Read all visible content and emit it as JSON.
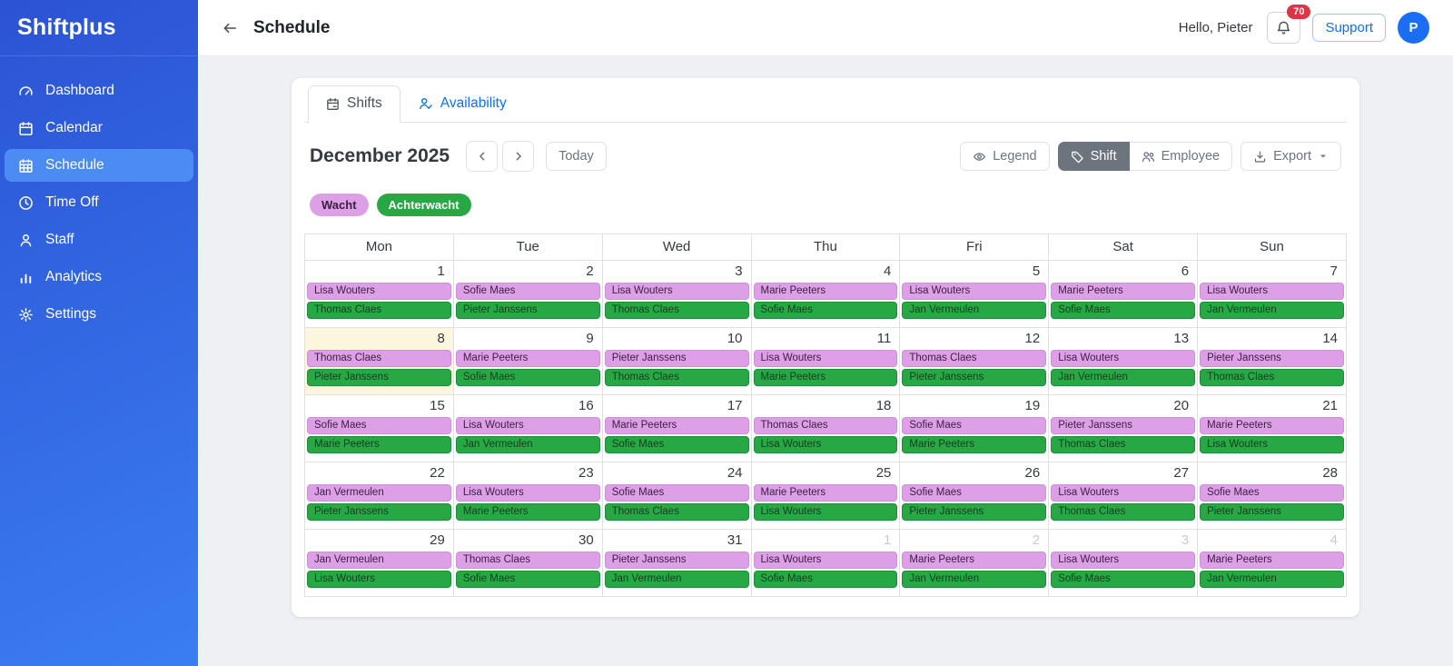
{
  "brand": "Shiftplus",
  "sidebar": {
    "items": [
      {
        "label": "Dashboard",
        "icon": "gauge-icon",
        "active": false
      },
      {
        "label": "Calendar",
        "icon": "calendar-icon",
        "active": false
      },
      {
        "label": "Schedule",
        "icon": "schedule-icon",
        "active": true
      },
      {
        "label": "Time Off",
        "icon": "clock-icon",
        "active": false
      },
      {
        "label": "Staff",
        "icon": "person-icon",
        "active": false
      },
      {
        "label": "Analytics",
        "icon": "bar-chart-icon",
        "active": false
      },
      {
        "label": "Settings",
        "icon": "gear-icon",
        "active": false
      }
    ]
  },
  "header": {
    "title": "Schedule",
    "greeting": "Hello, Pieter",
    "notification_count": "70",
    "support_label": "Support",
    "avatar_initial": "P"
  },
  "tabs": [
    {
      "label": "Shifts",
      "icon": "calendar-event-icon",
      "active": true
    },
    {
      "label": "Availability",
      "icon": "person-check-icon",
      "active": false
    }
  ],
  "toolbar": {
    "month_label": "December 2025",
    "today_label": "Today",
    "legend_label": "Legend",
    "shift_label": "Shift",
    "employee_label": "Employee",
    "export_label": "Export"
  },
  "legend": [
    {
      "label": "Wacht",
      "type": "wacht",
      "color": "#dd9fe5"
    },
    {
      "label": "Achterwacht",
      "type": "achter",
      "color": "#28a745"
    }
  ],
  "colors": {
    "sidebar_top": "#2b53d4",
    "sidebar_bottom": "#3b7df2",
    "active_nav": "#4a8bf4",
    "accent_blue": "#0d6efd",
    "badge_red": "#dc3545",
    "wacht_bg": "#dd9fe5",
    "achterwacht_bg": "#28a745",
    "today_bg": "#fdf6df"
  },
  "calendar": {
    "weekdays": [
      "Mon",
      "Tue",
      "Wed",
      "Thu",
      "Fri",
      "Sat",
      "Sun"
    ],
    "weeks": [
      [
        {
          "day": "1",
          "wacht": "Lisa Wouters",
          "achterwacht": "Thomas Claes"
        },
        {
          "day": "2",
          "wacht": "Sofie Maes",
          "achterwacht": "Pieter Janssens"
        },
        {
          "day": "3",
          "wacht": "Lisa Wouters",
          "achterwacht": "Thomas Claes"
        },
        {
          "day": "4",
          "wacht": "Marie Peeters",
          "achterwacht": "Sofie Maes"
        },
        {
          "day": "5",
          "wacht": "Lisa Wouters",
          "achterwacht": "Jan Vermeulen"
        },
        {
          "day": "6",
          "wacht": "Marie Peeters",
          "achterwacht": "Sofie Maes"
        },
        {
          "day": "7",
          "wacht": "Lisa Wouters",
          "achterwacht": "Jan Vermeulen"
        }
      ],
      [
        {
          "day": "8",
          "today": true,
          "wacht": "Thomas Claes",
          "achterwacht": "Pieter Janssens"
        },
        {
          "day": "9",
          "wacht": "Marie Peeters",
          "achterwacht": "Sofie Maes"
        },
        {
          "day": "10",
          "wacht": "Pieter Janssens",
          "achterwacht": "Thomas Claes"
        },
        {
          "day": "11",
          "wacht": "Lisa Wouters",
          "achterwacht": "Marie Peeters"
        },
        {
          "day": "12",
          "wacht": "Thomas Claes",
          "achterwacht": "Pieter Janssens"
        },
        {
          "day": "13",
          "wacht": "Lisa Wouters",
          "achterwacht": "Jan Vermeulen"
        },
        {
          "day": "14",
          "wacht": "Pieter Janssens",
          "achterwacht": "Thomas Claes"
        }
      ],
      [
        {
          "day": "15",
          "wacht": "Sofie Maes",
          "achterwacht": "Marie Peeters"
        },
        {
          "day": "16",
          "wacht": "Lisa Wouters",
          "achterwacht": "Jan Vermeulen"
        },
        {
          "day": "17",
          "wacht": "Marie Peeters",
          "achterwacht": "Sofie Maes"
        },
        {
          "day": "18",
          "wacht": "Thomas Claes",
          "achterwacht": "Lisa Wouters"
        },
        {
          "day": "19",
          "wacht": "Sofie Maes",
          "achterwacht": "Marie Peeters"
        },
        {
          "day": "20",
          "wacht": "Pieter Janssens",
          "achterwacht": "Thomas Claes"
        },
        {
          "day": "21",
          "wacht": "Marie Peeters",
          "achterwacht": "Lisa Wouters"
        }
      ],
      [
        {
          "day": "22",
          "wacht": "Jan Vermeulen",
          "achterwacht": "Pieter Janssens"
        },
        {
          "day": "23",
          "wacht": "Lisa Wouters",
          "achterwacht": "Marie Peeters"
        },
        {
          "day": "24",
          "wacht": "Sofie Maes",
          "achterwacht": "Thomas Claes"
        },
        {
          "day": "25",
          "wacht": "Marie Peeters",
          "achterwacht": "Lisa Wouters"
        },
        {
          "day": "26",
          "wacht": "Sofie Maes",
          "achterwacht": "Pieter Janssens"
        },
        {
          "day": "27",
          "wacht": "Lisa Wouters",
          "achterwacht": "Thomas Claes"
        },
        {
          "day": "28",
          "wacht": "Sofie Maes",
          "achterwacht": "Pieter Janssens"
        }
      ],
      [
        {
          "day": "29",
          "wacht": "Jan Vermeulen",
          "achterwacht": "Lisa Wouters"
        },
        {
          "day": "30",
          "wacht": "Thomas Claes",
          "achterwacht": "Sofie Maes"
        },
        {
          "day": "31",
          "wacht": "Pieter Janssens",
          "achterwacht": "Jan Vermeulen"
        },
        {
          "day": "1",
          "outside": true,
          "wacht": "Lisa Wouters",
          "achterwacht": "Sofie Maes"
        },
        {
          "day": "2",
          "outside": true,
          "wacht": "Marie Peeters",
          "achterwacht": "Jan Vermeulen"
        },
        {
          "day": "3",
          "outside": true,
          "wacht": "Lisa Wouters",
          "achterwacht": "Sofie Maes"
        },
        {
          "day": "4",
          "outside": true,
          "wacht": "Marie Peeters",
          "achterwacht": "Jan Vermeulen"
        }
      ]
    ]
  }
}
